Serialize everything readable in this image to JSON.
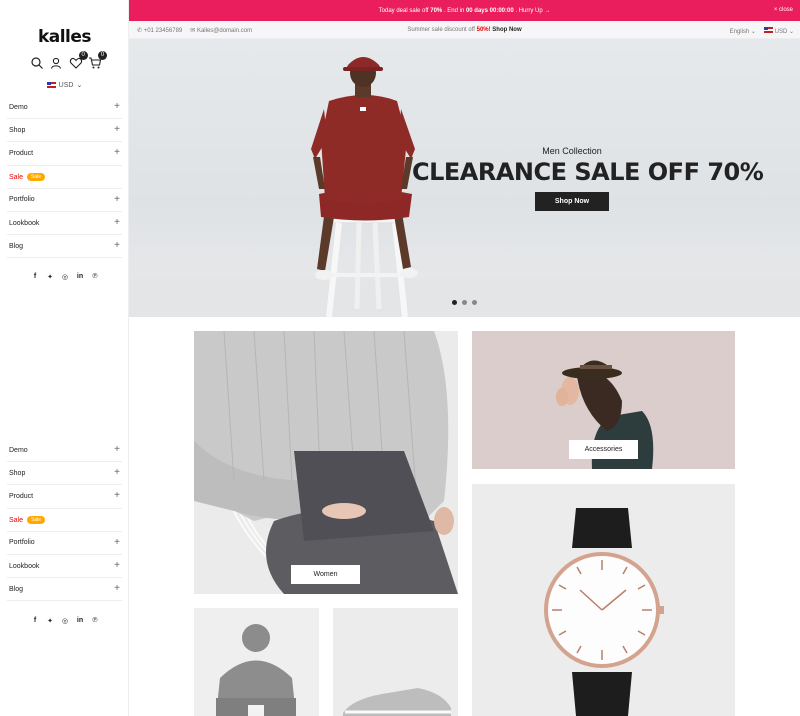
{
  "sidebar": {
    "logo": "kalles",
    "cart_count": "0",
    "wishlist_count": "0",
    "currency": "USD",
    "menu_top": [
      {
        "label": "Demo"
      },
      {
        "label": "Shop"
      },
      {
        "label": "Product"
      },
      {
        "label": "Sale",
        "badge": "Sale"
      },
      {
        "label": "Portfolio"
      },
      {
        "label": "Lookbook"
      },
      {
        "label": "Blog"
      }
    ],
    "menu_bottom": [
      {
        "label": "Demo"
      },
      {
        "label": "Shop"
      },
      {
        "label": "Product"
      },
      {
        "label": "Sale",
        "badge": "Sale"
      },
      {
        "label": "Portfolio"
      },
      {
        "label": "Lookbook"
      },
      {
        "label": "Blog"
      }
    ],
    "social": [
      "f",
      "t",
      "ig",
      "in",
      "p"
    ]
  },
  "topbar": {
    "text1": "Today deal sale off",
    "pct": "70%",
    "text2": ". End in",
    "days": "00 days 00:00:00",
    "text3": ". Hurry Up →",
    "close": "× close"
  },
  "infobar": {
    "phone": "+01 23456789",
    "email": "Kalles@domain.com",
    "promo_text": "Summer sale discount off",
    "promo_pct": "50%!",
    "promo_link": "Shop Now",
    "language": "English",
    "currency": "USD"
  },
  "hero": {
    "subtitle": "Men Collection",
    "title": "CLEARANCE SALE OFF 70%",
    "button": "Shop Now",
    "slides": 3,
    "active_slide": 1
  },
  "tiles": {
    "women": "Women",
    "accessories": "Accessories"
  },
  "colors": {
    "accent": "#ea1d5d",
    "sale": "#ec0101",
    "badge": "#ffa800"
  }
}
